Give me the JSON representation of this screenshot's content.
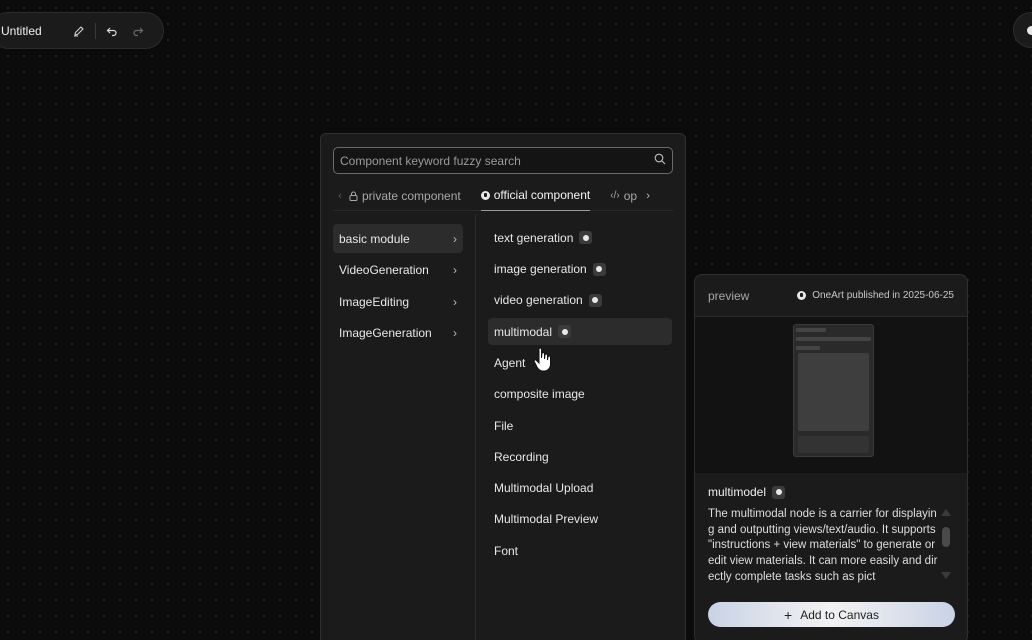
{
  "toolbar": {
    "title": "Untitled",
    "icons": [
      "edit-icon",
      "undo-icon",
      "redo-icon"
    ]
  },
  "search": {
    "placeholder": "Component keyword fuzzy search",
    "value": ""
  },
  "tabs": [
    {
      "label": "private component",
      "icon": "lock-icon",
      "active": false
    },
    {
      "label": "official component",
      "icon": "official-badge-icon",
      "active": true
    },
    {
      "label": "op",
      "icon": "code-icon",
      "active": false
    }
  ],
  "categories": [
    {
      "label": "basic module",
      "active": true
    },
    {
      "label": "VideoGeneration",
      "active": false
    },
    {
      "label": "ImageEditing",
      "active": false
    },
    {
      "label": "ImageGeneration",
      "active": false
    }
  ],
  "components": [
    {
      "label": "text generation",
      "badge": true
    },
    {
      "label": "image generation",
      "badge": true
    },
    {
      "label": "video generation",
      "badge": true
    },
    {
      "label": "multimodal",
      "badge": true,
      "hover": true
    },
    {
      "label": "Agent",
      "badge": false
    },
    {
      "label": "composite image",
      "badge": false
    },
    {
      "label": "File",
      "badge": false
    },
    {
      "label": "Recording",
      "badge": false
    },
    {
      "label": "Multimodal Upload",
      "badge": false
    },
    {
      "label": "Multimodal Preview",
      "badge": false
    },
    {
      "label": "Font",
      "badge": false
    }
  ],
  "preview": {
    "title": "preview",
    "meta": "OneArt published in 2025-06-25",
    "name": "multimodel",
    "description": "The multimodal node is a carrier for displaying and outputting views/text/audio. It supports \"instructions + view materials\" to generate or edit view materials. It can more easily and directly complete tasks such as pict",
    "add_button": "Add to Canvas"
  },
  "colors": {
    "background": "#0b0b0b",
    "panel": "#1b1b1b",
    "accent": "#e8e8e8"
  }
}
